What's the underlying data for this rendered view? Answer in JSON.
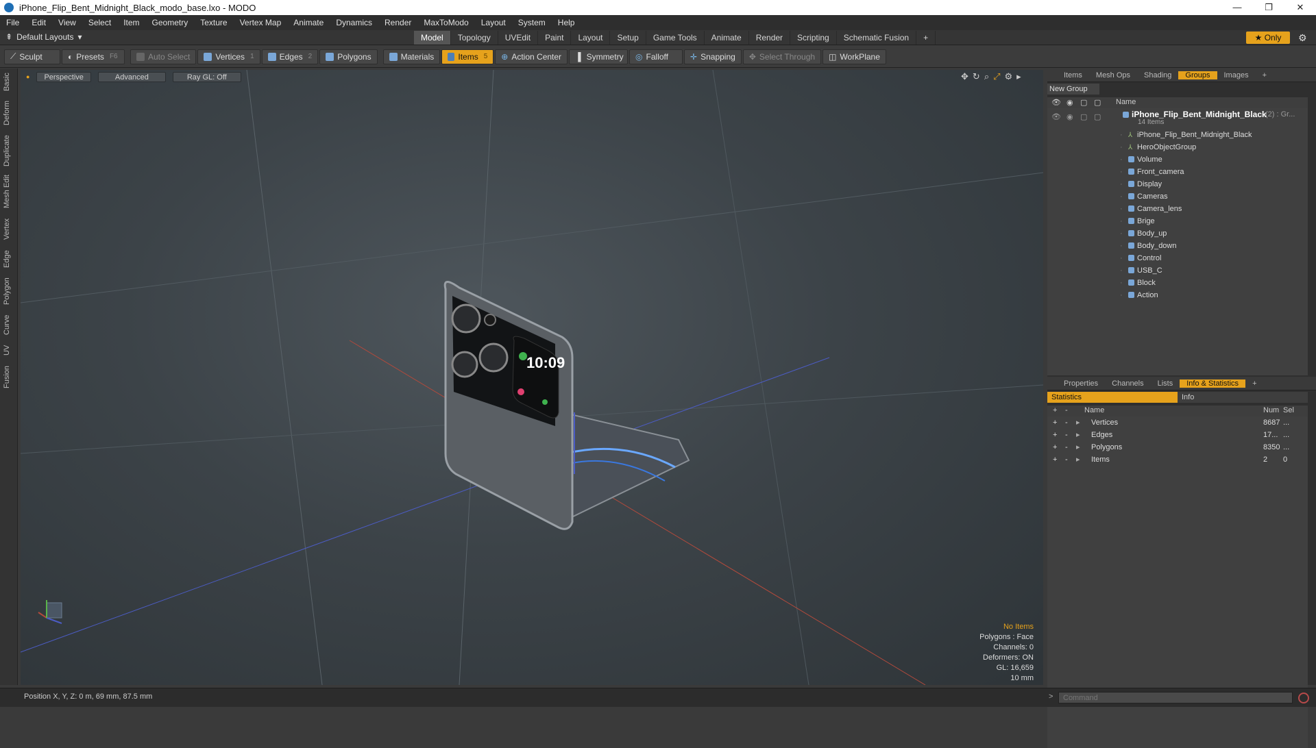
{
  "window": {
    "title": "iPhone_Flip_Bent_Midnight_Black_modo_base.lxo - MODO",
    "controls": [
      "—",
      "❐",
      "✕"
    ]
  },
  "menu": [
    "File",
    "Edit",
    "View",
    "Select",
    "Item",
    "Geometry",
    "Texture",
    "Vertex Map",
    "Animate",
    "Dynamics",
    "Render",
    "MaxToModo",
    "Layout",
    "System",
    "Help"
  ],
  "layoutbar": {
    "layouts_label": "Default Layouts",
    "tabs": [
      "Model",
      "Topology",
      "UVEdit",
      "Paint",
      "Layout",
      "Setup",
      "Game Tools",
      "Animate",
      "Render",
      "Scripting",
      "Schematic Fusion"
    ],
    "active_tab": "Model",
    "add": "+",
    "only_label": "Only"
  },
  "toolbar": {
    "sculpt": "Sculpt",
    "presets": "Presets",
    "presets_key": "F6",
    "auto_select": "Auto Select",
    "vertices": "Vertices",
    "vertices_key": "1",
    "edges": "Edges",
    "edges_key": "2",
    "polygons": "Polygons",
    "materials": "Materials",
    "items": "Items",
    "items_key": "5",
    "action_center": "Action Center",
    "symmetry": "Symmetry",
    "falloff": "Falloff",
    "snapping": "Snapping",
    "select_through": "Select Through",
    "workplane": "WorkPlane"
  },
  "left_tabs": [
    "Basic",
    "Deform",
    "Duplicate",
    "Mesh Edit",
    "Vertex",
    "Edge",
    "Polygon",
    "Curve",
    "UV",
    "Fusion"
  ],
  "viewport": {
    "perspective": "Perspective",
    "advanced": "Advanced",
    "raygl": "Ray GL: Off",
    "hud": {
      "no_items": "No Items",
      "polygons": "Polygons : Face",
      "channels": "Channels: 0",
      "deformers": "Deformers: ON",
      "gl": "GL: 16,659",
      "scale": "10 mm"
    },
    "phone_time": "10:09"
  },
  "groups_panel": {
    "tabs": [
      "Items",
      "Mesh Ops",
      "Shading",
      "Groups",
      "Images"
    ],
    "active_tab": "Groups",
    "new_group": "New Group",
    "col_name": "Name",
    "root": {
      "name": "iPhone_Flip_Bent_Midnight_Black",
      "suffix": "(2) : Gr...",
      "count": "14 Items"
    },
    "children": [
      "iPhone_Flip_Bent_Midnight_Black",
      "HeroObjectGroup",
      "Volume",
      "Front_camera",
      "Display",
      "Cameras",
      "Camera_lens",
      "Brige",
      "Body_up",
      "Body_down",
      "Control",
      "USB_C",
      "Block",
      "Action"
    ]
  },
  "stats_panel": {
    "tabs": [
      "Properties",
      "Channels",
      "Lists",
      "Info & Statistics"
    ],
    "active_tab": "Info & Statistics",
    "sub_tabs": [
      "Statistics",
      "Info"
    ],
    "columns": [
      "Name",
      "Num",
      "Sel"
    ],
    "rows": [
      {
        "name": "Vertices",
        "num": "8687",
        "sel": "..."
      },
      {
        "name": "Edges",
        "num": "17...",
        "sel": "..."
      },
      {
        "name": "Polygons",
        "num": "8350",
        "sel": "..."
      },
      {
        "name": "Items",
        "num": "2",
        "sel": "0"
      }
    ]
  },
  "status": {
    "position": "Position X, Y, Z:  0 m, 69 mm, 87.5 mm",
    "command_placeholder": "Command"
  },
  "colors": {
    "accent": "#e6a21c",
    "panel": "#2f2f2f",
    "viewport": "#3c4348"
  }
}
